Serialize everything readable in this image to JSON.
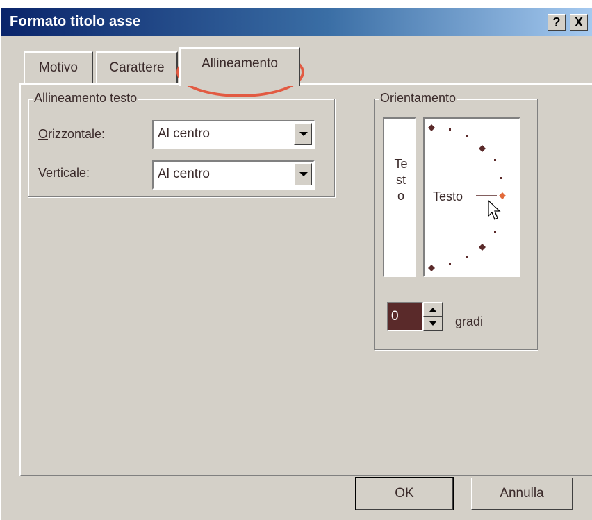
{
  "window": {
    "title": "Formato titolo asse",
    "help_label": "?",
    "close_label": "X"
  },
  "tabs": [
    {
      "label": "Motivo",
      "active": false
    },
    {
      "label": "Carattere",
      "active": false
    },
    {
      "label": "Allineamento",
      "active": true
    }
  ],
  "text_alignment": {
    "legend": "Allineamento testo",
    "horizontal": {
      "label_first": "O",
      "label_rest": "rizzontale:",
      "value": "Al centro"
    },
    "vertical": {
      "label_first": "V",
      "label_rest": "erticale:",
      "value": "Al centro"
    }
  },
  "orientation": {
    "legend": "Orientamento",
    "vertical_text": "Testo",
    "dial_text": "Testo",
    "degrees_value": "0",
    "degrees_label_first": "g",
    "degrees_label_rest": "radi"
  },
  "buttons": {
    "ok": "OK",
    "cancel": "Annulla"
  },
  "colors": {
    "accent_marker": "#e26a3a",
    "highlight_oval": "#e25a42",
    "dark_dot": "#5a2a2a"
  }
}
